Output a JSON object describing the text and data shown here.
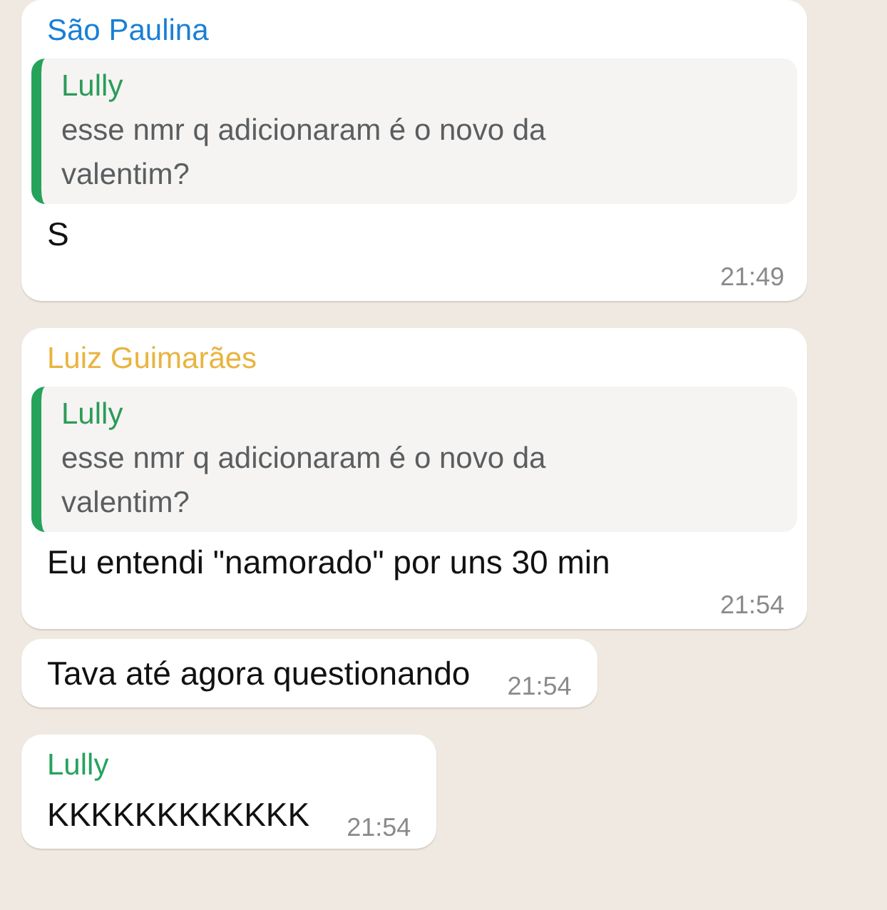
{
  "messages": [
    {
      "sender": {
        "name": "São Paulina",
        "color": "#1a7fd6"
      },
      "quote": {
        "author": "Lully",
        "text": "esse nmr q adicionaram é o novo da valentim?"
      },
      "text": "S",
      "time": "21:49",
      "kind": "stacked"
    },
    {
      "sender": {
        "name": "Luiz Guimarães",
        "color": "#e9b43f"
      },
      "quote": {
        "author": "Lully",
        "text": "esse nmr q adicionaram é o novo da valentim?"
      },
      "text": "Eu entendi \"namorado\" por uns 30 min",
      "time": "21:54",
      "kind": "stacked"
    },
    {
      "text": "Tava até agora questionando",
      "time": "21:54",
      "kind": "inline"
    },
    {
      "sender": {
        "name": "Lully",
        "color": "#26a35d"
      },
      "text": "KKKKKKKKKKKK",
      "time": "21:54",
      "kind": "inline"
    }
  ]
}
